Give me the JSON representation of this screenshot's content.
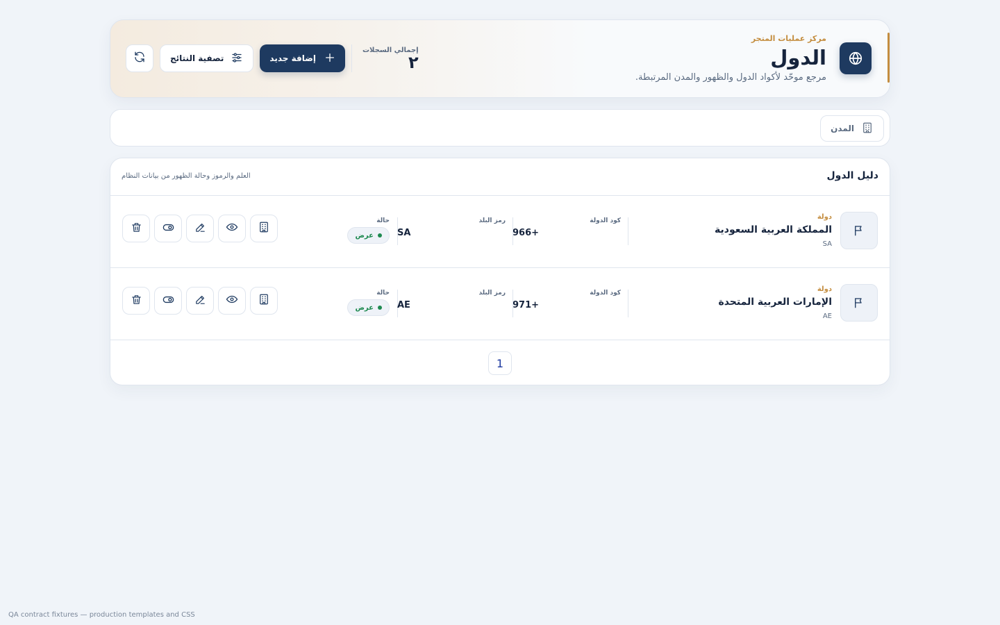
{
  "header": {
    "eyebrow": "مركز عمليات المتجر",
    "title": "الدول",
    "subtitle": "مرجع موحّد لأكواد الدول والظهور والمدن المرتبطة.",
    "stat_label": "إجمالي السجلات",
    "stat_value": "٢",
    "add_label": "إضافة جديد",
    "filter_label": "تصفية النتائج",
    "accent_color": "#c48d3f",
    "brand_color": "#1e3a60"
  },
  "tabs": [
    {
      "label": "المدن",
      "icon": "building-icon"
    }
  ],
  "directory": {
    "title": "دليل الدول",
    "subtitle": "العلم والرموز وحالة الظهور من بيانات النظام",
    "column_labels": {
      "dial_code": "كود الدولة",
      "country_code": "رمز البلد",
      "status": "حالة"
    },
    "rows": [
      {
        "type": "دولة",
        "name": "المملكة العربية السعودية",
        "iso": "SA",
        "dial_code": "966+",
        "country_code": "SA",
        "status": "عرض"
      },
      {
        "type": "دولة",
        "name": "الإمارات العربية المتحدة",
        "iso": "AE",
        "dial_code": "971+",
        "country_code": "AE",
        "status": "عرض"
      }
    ],
    "row_actions": [
      "cities-icon",
      "view-icon",
      "edit-icon",
      "toggle-icon",
      "delete-icon"
    ]
  },
  "pagination": {
    "current": "1"
  },
  "footer": {
    "text": "QA contract fixtures — production templates and CSS"
  }
}
